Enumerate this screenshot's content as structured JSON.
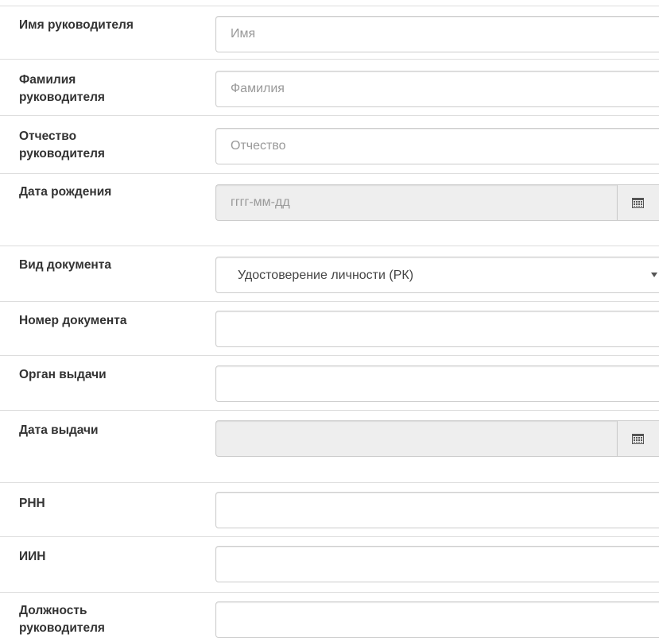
{
  "form": {
    "manager_first_name": {
      "label": "Имя руководителя",
      "value": "",
      "placeholder": "Имя"
    },
    "manager_last_name": {
      "label": "Фамилия руководителя",
      "value": "",
      "placeholder": "Фамилия"
    },
    "manager_patronymic": {
      "label": "Отчество руководителя",
      "value": "",
      "placeholder": "Отчество"
    },
    "birth_date": {
      "label": "Дата рождения",
      "value": "",
      "placeholder": "гггг-мм-дд",
      "icon": "calendar-icon"
    },
    "document_type": {
      "label": "Вид документа",
      "selected": "Удостоверение личности (РК)",
      "icon": "caret-down-icon"
    },
    "document_number": {
      "label": "Номер документа",
      "value": "",
      "placeholder": ""
    },
    "issuing_authority": {
      "label": "Орган выдачи",
      "value": "",
      "placeholder": ""
    },
    "issue_date": {
      "label": "Дата выдачи",
      "value": "",
      "placeholder": "",
      "icon": "calendar-icon"
    },
    "rnn": {
      "label": "РНН",
      "value": "",
      "placeholder": ""
    },
    "iin": {
      "label": "ИИН",
      "value": "",
      "placeholder": ""
    },
    "manager_position": {
      "label": "Должность руководителя",
      "value": "",
      "placeholder": ""
    }
  }
}
